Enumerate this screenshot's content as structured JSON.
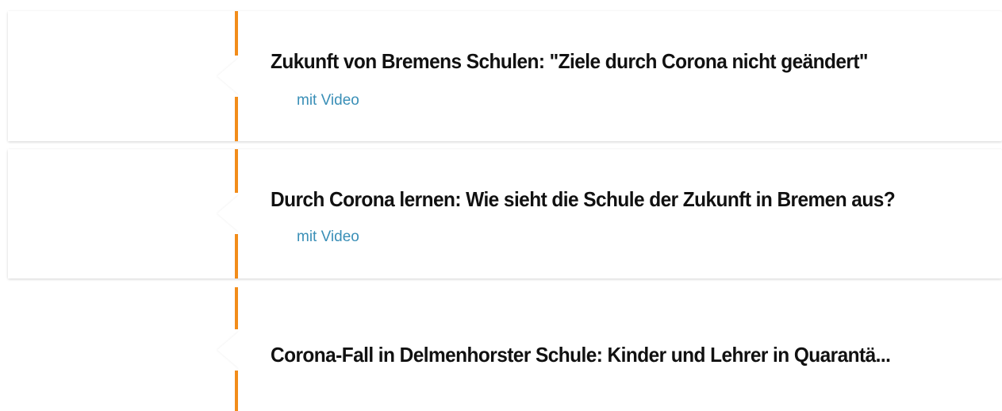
{
  "articles": [
    {
      "title": "Zukunft von Bremens Schulen: \"Ziele durch Corona nicht geändert\"",
      "tag": "mit Video"
    },
    {
      "title": "Durch Corona lernen: Wie sieht die Schule der Zukunft in Bremen aus?",
      "tag": "mit Video"
    },
    {
      "title": "Corona-Fall in Delmenhorster Schule: Kinder und Lehrer in Quarantä..."
    }
  ],
  "colors": {
    "accent": "#f28c1a",
    "link": "#3a8fb7",
    "text": "#111111",
    "background": "#ffffff"
  }
}
